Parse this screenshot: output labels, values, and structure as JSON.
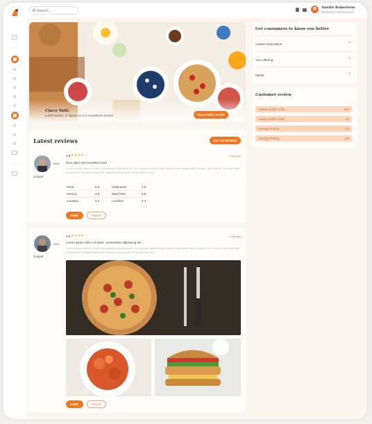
{
  "header": {
    "search_placeholder": "Search...",
    "user_name": "Austin Robertson",
    "user_role": "Marketing Administrator"
  },
  "hero": {
    "title": "Cinco Tutti",
    "subtitle": "Lorem ipsum, or lipsum as it is sometimes known",
    "profile_button": "View Public Profile"
  },
  "latest_reviews": {
    "title": "Latest reviews",
    "see_all_label": "See All Reviews"
  },
  "review1": {
    "tag": "Jonie",
    "author": "Cooper",
    "rating": "4.8",
    "stars": "★★★★☆",
    "time": "1 day ago",
    "headline": "Nice place and excellent food",
    "body": "Lorem ipsum dolor sit amet, consectetur adipiscing elit. Dui egestas pellentesque lacus suspendisse eget suscipit. Orci viverra. Leo eget vitae elementum. Facilisis bibendum. Egestas sit nisl amet. Enim ultricies nec.",
    "scores_left": [
      {
        "label": "Food",
        "value": "4.0"
      },
      {
        "label": "Service",
        "value": "3.9"
      },
      {
        "label": "Location",
        "value": "4.2"
      }
    ],
    "scores_right": [
      {
        "label": "Cleanness",
        "value": "4.8"
      },
      {
        "label": "Wait Time",
        "value": "4.8"
      },
      {
        "label": "Location",
        "value": "4.3"
      }
    ],
    "reply_label": "Reply",
    "report_label": "Report"
  },
  "review2": {
    "tag": "Jonie",
    "author": "Cooper",
    "rating": "4.6",
    "stars": "★★★★☆",
    "time": "1 day ago",
    "headline": "Lorem ipsum dolor sit amet, consectetur adipiscing elit.",
    "body": "Lorem ipsum dolor sit amet, consectetur adipiscing elit. Dui egestas pellentesque lacus suspendisse eget suscipit. Orci viverra. Leo eget vitae elementum. Facilisis bibendum. Egestas sit nisl amet. Enim ultricies nec.",
    "reply_label": "Reply",
    "report_label": "Report"
  },
  "consumers": {
    "title": "Get consumers to know you better",
    "items": [
      "contact Information",
      "Your offering",
      "Media"
    ]
  },
  "customer_review": {
    "title": "Customer review",
    "rows": [
      {
        "label": "unique profile visits",
        "value": "224"
      },
      {
        "label": "unique profile visits",
        "value": "22"
      },
      {
        "label": "average Rating",
        "value": "4.8"
      },
      {
        "label": "average Rating",
        "value": "4.8"
      }
    ]
  },
  "colors": {
    "accent": "#f0761f",
    "tag_bg": "#fad6bd"
  }
}
